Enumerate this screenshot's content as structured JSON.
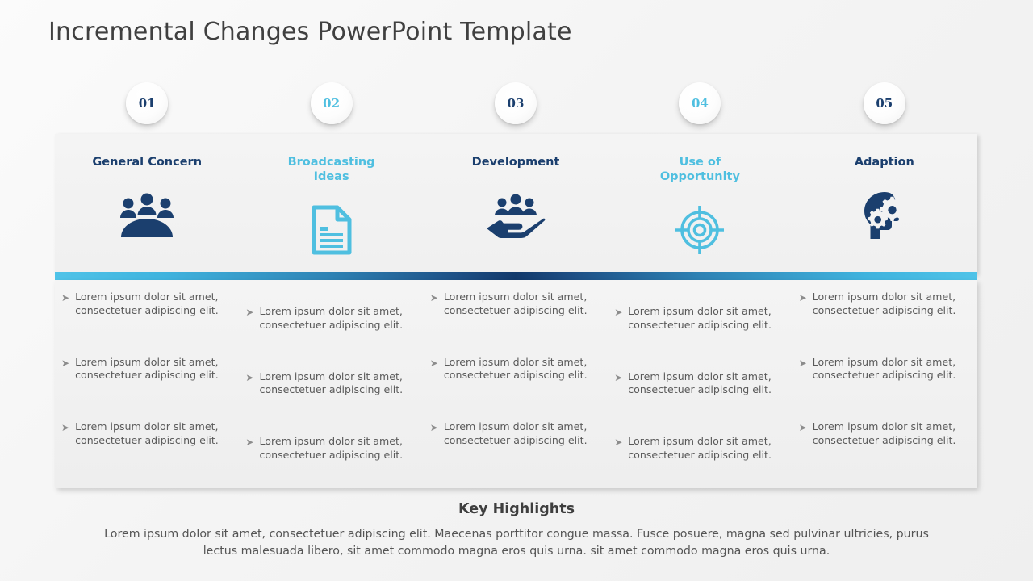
{
  "slide": {
    "title": "Incremental Changes PowerPoint Template"
  },
  "colors": {
    "dark_navy": "#1b3f6e",
    "light_blue": "#4fbfe0",
    "bar_light": "#4fc3e8",
    "bar_dark": "#12396b",
    "bullet_text": "#5a5a5a",
    "title_text": "#404040"
  },
  "columns": [
    {
      "number": "01",
      "number_color": "#1b3f6e",
      "header": "General Concern",
      "header_color": "#1b3f6e",
      "icon": "group-meeting-icon",
      "icon_color": "#1b3f6e",
      "bullets": [
        "Lorem ipsum dolor sit amet, consectetuer adipiscing elit.",
        "Lorem ipsum dolor sit amet, consectetuer adipiscing elit.",
        "Lorem ipsum dolor sit amet, consectetuer adipiscing elit."
      ]
    },
    {
      "number": "02",
      "number_color": "#4fbfe0",
      "header": "Broadcasting Ideas",
      "header_color": "#4fbfe0",
      "icon": "document-file-icon",
      "icon_color": "#4fbfe0",
      "bullets": [
        "Lorem ipsum dolor sit amet, consectetuer adipiscing elit.",
        "Lorem ipsum dolor sit amet, consectetuer adipiscing elit.",
        "Lorem ipsum dolor sit amet, consectetuer adipiscing elit."
      ]
    },
    {
      "number": "03",
      "number_color": "#1b3f6e",
      "header": "Development",
      "header_color": "#1b3f6e",
      "icon": "hand-holding-people-icon",
      "icon_color": "#1b3f6e",
      "bullets": [
        "Lorem ipsum dolor sit amet, consectetuer adipiscing elit.",
        "Lorem ipsum dolor sit amet, consectetuer adipiscing elit.",
        "Lorem ipsum dolor sit amet, consectetuer adipiscing elit."
      ]
    },
    {
      "number": "04",
      "number_color": "#4fbfe0",
      "header": "Use of Opportunity",
      "header_color": "#4fbfe0",
      "icon": "target-crosshair-icon",
      "icon_color": "#4fbfe0",
      "bullets": [
        "Lorem ipsum dolor sit amet, consectetuer adipiscing elit.",
        "Lorem ipsum dolor sit amet, consectetuer adipiscing elit.",
        "Lorem ipsum dolor sit amet, consectetuer adipiscing elit."
      ]
    },
    {
      "number": "05",
      "number_color": "#1b3f6e",
      "header": "Adaption",
      "header_color": "#1b3f6e",
      "icon": "head-with-gears-icon",
      "icon_color": "#1b3f6e",
      "bullets": [
        "Lorem ipsum dolor sit amet, consectetuer adipiscing elit.",
        "Lorem ipsum dolor sit amet, consectetuer adipiscing elit.",
        "Lorem ipsum dolor sit amet, consectetuer adipiscing elit."
      ]
    }
  ],
  "bullet_glyph": "➤",
  "key_highlights": {
    "title": "Key Highlights",
    "body": "Lorem ipsum dolor sit amet, consectetuer adipiscing elit. Maecenas porttitor congue massa. Fusce posuere, magna sed pulvinar ultricies, purus lectus malesuada libero, sit amet commodo magna eros quis urna. sit amet commodo magna eros quis urna."
  }
}
